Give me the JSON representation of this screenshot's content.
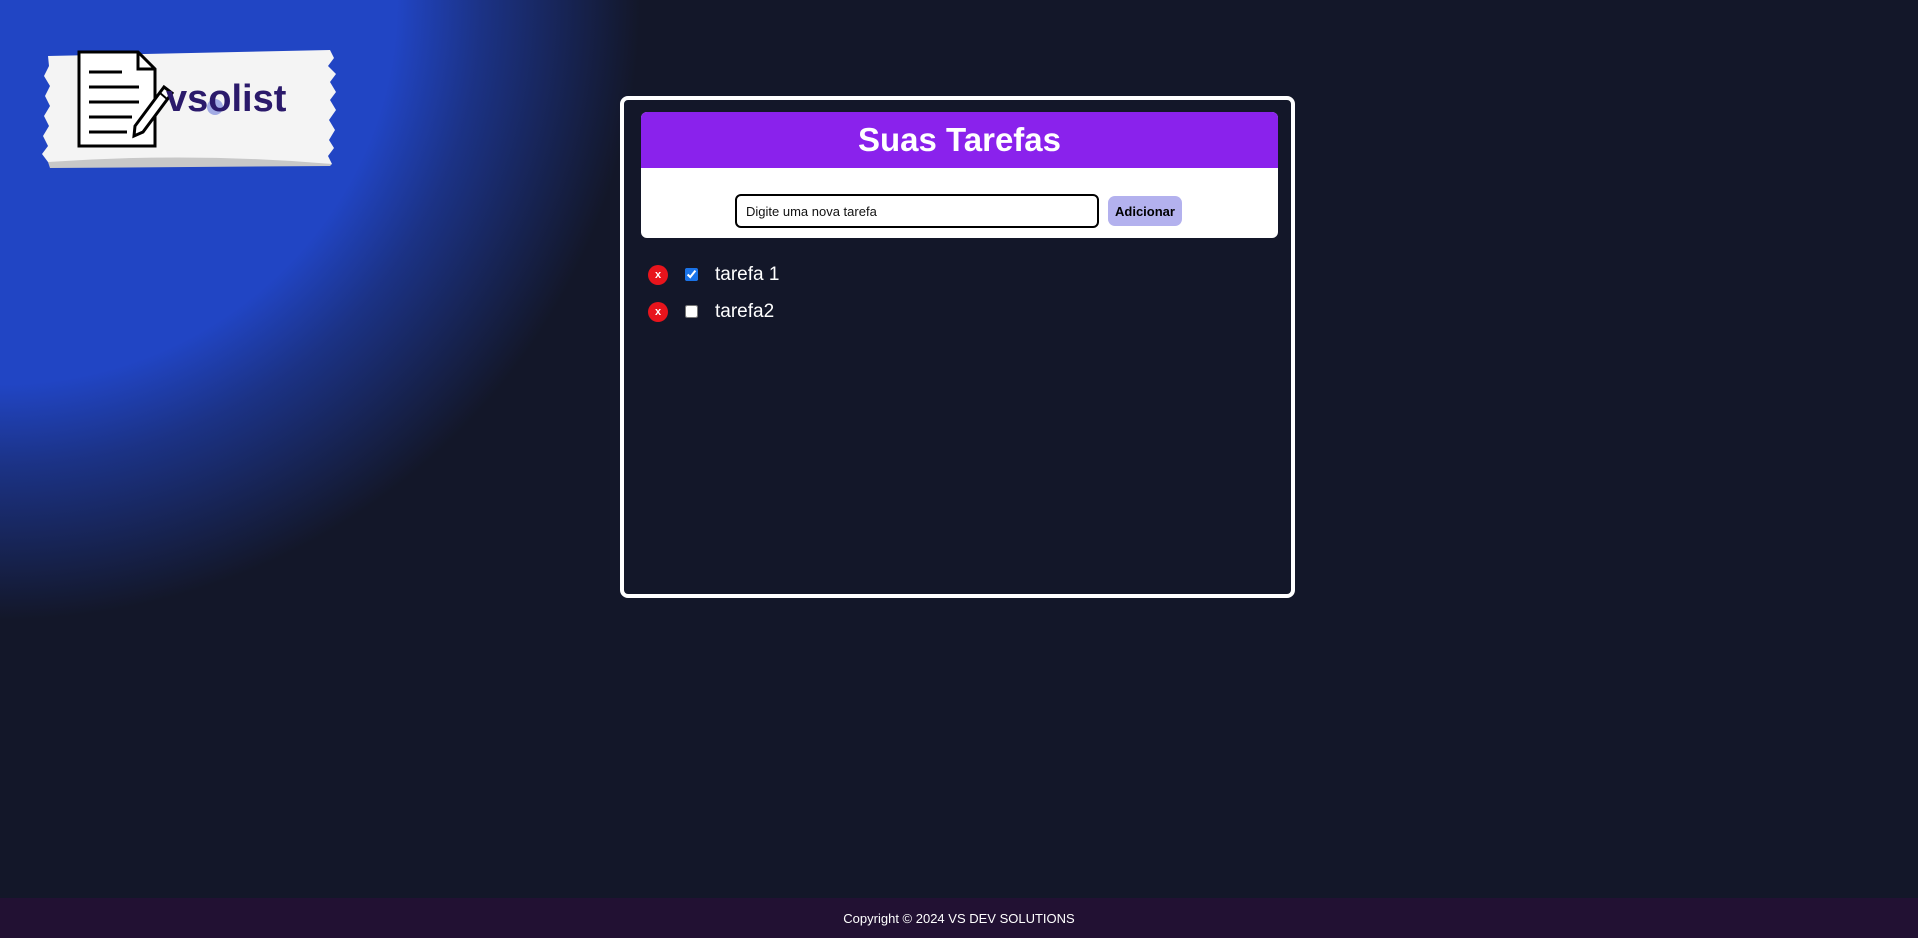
{
  "app": {
    "logo_text": "vsolist"
  },
  "header": {
    "title": "Suas Tarefas"
  },
  "form": {
    "input_placeholder": "Digite uma nova tarefa",
    "input_value": "",
    "add_label": "Adicionar"
  },
  "tasks": [
    {
      "label": "tarefa 1",
      "done": true,
      "delete_label": "x"
    },
    {
      "label": "tarefa2",
      "done": false,
      "delete_label": "x"
    }
  ],
  "footer": {
    "text": "Copyright © 2024 VS DEV SOLUTIONS"
  },
  "colors": {
    "accent": "#8a22ec",
    "button": "#b3b1ee",
    "delete": "#e8141c",
    "background": "#131729",
    "glow": "#2145c4"
  },
  "icons": {
    "logo": "notepad-pencil-icon",
    "delete": "close-icon"
  }
}
